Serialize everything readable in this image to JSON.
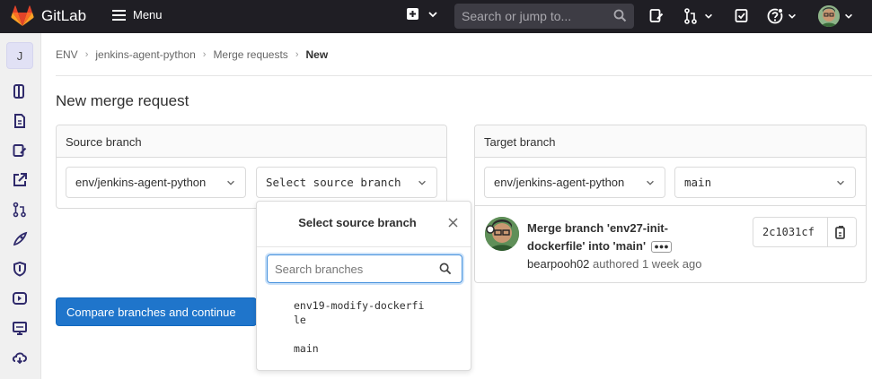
{
  "topbar": {
    "app_name": "GitLab",
    "menu_label": "Menu",
    "search_placeholder": "Search or jump to..."
  },
  "sidebar": {
    "project_initial": "J",
    "items": [
      "project-overview-icon",
      "repository-icon",
      "issues-icon",
      "external-link-icon",
      "merge-requests-icon",
      "deployments-icon",
      "security-icon",
      "ci-cd-icon",
      "monitor-icon",
      "packages-icon"
    ]
  },
  "breadcrumb": {
    "items": [
      "ENV",
      "jenkins-agent-python",
      "Merge requests",
      "New"
    ]
  },
  "page": {
    "title": "New merge request"
  },
  "source": {
    "heading": "Source branch",
    "project": "env/jenkins-agent-python",
    "branch_placeholder": "Select source branch"
  },
  "target": {
    "heading": "Target branch",
    "project": "env/jenkins-agent-python",
    "branch": "main"
  },
  "popup": {
    "title": "Select source branch",
    "search_placeholder": "Search branches",
    "branches": [
      "env19-modify-dockerfi",
      "le",
      "main"
    ]
  },
  "commit": {
    "title_line1": "Merge branch 'env27-init-",
    "title_line2": "dockerfile' into 'main'",
    "author": "bearpooh02",
    "authored_text": "authored 1 week ago",
    "sha": "2c1031cf"
  },
  "actions": {
    "compare_label": "Compare branches and continue"
  },
  "colors": {
    "topbar_bg": "#1f1e24",
    "primary": "#1f75cb",
    "focus": "#428fdc"
  }
}
